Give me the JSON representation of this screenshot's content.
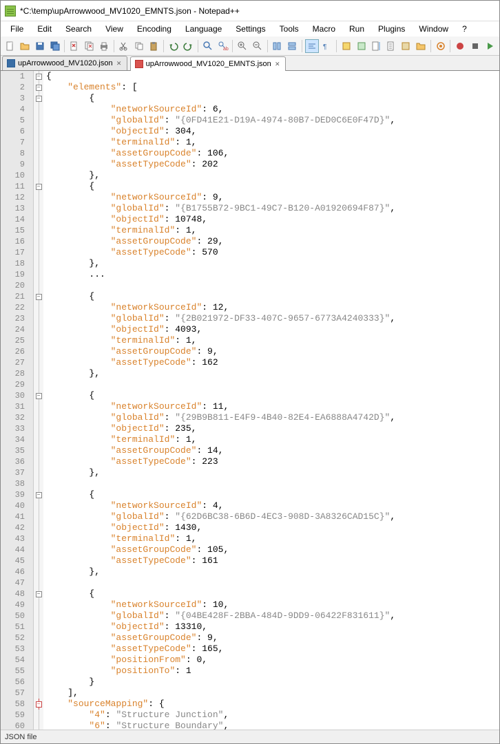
{
  "title": "*C:\\temp\\upArrowwood_MV1020_EMNTS.json - Notepad++",
  "menu": [
    "File",
    "Edit",
    "Search",
    "View",
    "Encoding",
    "Language",
    "Settings",
    "Tools",
    "Macro",
    "Run",
    "Plugins",
    "Window",
    "?"
  ],
  "tabs": [
    {
      "label": "upArrowwood_MV1020.json",
      "modified": false
    },
    {
      "label": "upArrowwood_MV1020_EMNTS.json",
      "modified": true
    }
  ],
  "active_tab": 1,
  "status": "JSON file",
  "code_lines": [
    {
      "n": 1,
      "fold": "open",
      "t": [
        {
          "c": "p",
          "v": "{"
        }
      ]
    },
    {
      "n": 2,
      "fold": "open",
      "t": [
        {
          "c": "p",
          "v": "    "
        },
        {
          "c": "k",
          "v": "\"elements\""
        },
        {
          "c": "p",
          "v": ": ["
        }
      ]
    },
    {
      "n": 3,
      "fold": "open",
      "t": [
        {
          "c": "p",
          "v": "        {"
        }
      ]
    },
    {
      "n": 4,
      "t": [
        {
          "c": "p",
          "v": "            "
        },
        {
          "c": "k",
          "v": "\"networkSourceId\""
        },
        {
          "c": "p",
          "v": ": 6,"
        }
      ]
    },
    {
      "n": 5,
      "t": [
        {
          "c": "p",
          "v": "            "
        },
        {
          "c": "k",
          "v": "\"globalId\""
        },
        {
          "c": "p",
          "v": ": "
        },
        {
          "c": "s",
          "v": "\"{0FD41E21-D19A-4974-80B7-DED0C6E0F47D}\""
        },
        {
          "c": "p",
          "v": ","
        }
      ]
    },
    {
      "n": 6,
      "t": [
        {
          "c": "p",
          "v": "            "
        },
        {
          "c": "k",
          "v": "\"objectId\""
        },
        {
          "c": "p",
          "v": ": 304,"
        }
      ]
    },
    {
      "n": 7,
      "t": [
        {
          "c": "p",
          "v": "            "
        },
        {
          "c": "k",
          "v": "\"terminalId\""
        },
        {
          "c": "p",
          "v": ": 1,"
        }
      ]
    },
    {
      "n": 8,
      "t": [
        {
          "c": "p",
          "v": "            "
        },
        {
          "c": "k",
          "v": "\"assetGroupCode\""
        },
        {
          "c": "p",
          "v": ": 106,"
        }
      ]
    },
    {
      "n": 9,
      "t": [
        {
          "c": "p",
          "v": "            "
        },
        {
          "c": "k",
          "v": "\"assetTypeCode\""
        },
        {
          "c": "p",
          "v": ": 202"
        }
      ]
    },
    {
      "n": 10,
      "t": [
        {
          "c": "p",
          "v": "        },"
        }
      ]
    },
    {
      "n": 11,
      "fold": "open",
      "t": [
        {
          "c": "p",
          "v": "        {"
        }
      ]
    },
    {
      "n": 12,
      "t": [
        {
          "c": "p",
          "v": "            "
        },
        {
          "c": "k",
          "v": "\"networkSourceId\""
        },
        {
          "c": "p",
          "v": ": 9,"
        }
      ]
    },
    {
      "n": 13,
      "t": [
        {
          "c": "p",
          "v": "            "
        },
        {
          "c": "k",
          "v": "\"globalId\""
        },
        {
          "c": "p",
          "v": ": "
        },
        {
          "c": "s",
          "v": "\"{B1755B72-9BC1-49C7-B120-A01920694F87}\""
        },
        {
          "c": "p",
          "v": ","
        }
      ]
    },
    {
      "n": 14,
      "t": [
        {
          "c": "p",
          "v": "            "
        },
        {
          "c": "k",
          "v": "\"objectId\""
        },
        {
          "c": "p",
          "v": ": 10748,"
        }
      ]
    },
    {
      "n": 15,
      "t": [
        {
          "c": "p",
          "v": "            "
        },
        {
          "c": "k",
          "v": "\"terminalId\""
        },
        {
          "c": "p",
          "v": ": 1,"
        }
      ]
    },
    {
      "n": 16,
      "t": [
        {
          "c": "p",
          "v": "            "
        },
        {
          "c": "k",
          "v": "\"assetGroupCode\""
        },
        {
          "c": "p",
          "v": ": 29,"
        }
      ]
    },
    {
      "n": 17,
      "t": [
        {
          "c": "p",
          "v": "            "
        },
        {
          "c": "k",
          "v": "\"assetTypeCode\""
        },
        {
          "c": "p",
          "v": ": 570"
        }
      ]
    },
    {
      "n": 18,
      "t": [
        {
          "c": "p",
          "v": "        },"
        }
      ]
    },
    {
      "n": 19,
      "t": [
        {
          "c": "p",
          "v": "        ..."
        }
      ]
    },
    {
      "n": 20,
      "t": [
        {
          "c": "p",
          "v": ""
        }
      ]
    },
    {
      "n": 21,
      "fold": "open",
      "t": [
        {
          "c": "p",
          "v": "        {"
        }
      ]
    },
    {
      "n": 22,
      "t": [
        {
          "c": "p",
          "v": "            "
        },
        {
          "c": "k",
          "v": "\"networkSourceId\""
        },
        {
          "c": "p",
          "v": ": 12,"
        }
      ]
    },
    {
      "n": 23,
      "t": [
        {
          "c": "p",
          "v": "            "
        },
        {
          "c": "k",
          "v": "\"globalId\""
        },
        {
          "c": "p",
          "v": ": "
        },
        {
          "c": "s",
          "v": "\"{2B021972-DF33-407C-9657-6773A4240333}\""
        },
        {
          "c": "p",
          "v": ","
        }
      ]
    },
    {
      "n": 24,
      "t": [
        {
          "c": "p",
          "v": "            "
        },
        {
          "c": "k",
          "v": "\"objectId\""
        },
        {
          "c": "p",
          "v": ": 4093,"
        }
      ]
    },
    {
      "n": 25,
      "t": [
        {
          "c": "p",
          "v": "            "
        },
        {
          "c": "k",
          "v": "\"terminalId\""
        },
        {
          "c": "p",
          "v": ": 1,"
        }
      ]
    },
    {
      "n": 26,
      "t": [
        {
          "c": "p",
          "v": "            "
        },
        {
          "c": "k",
          "v": "\"assetGroupCode\""
        },
        {
          "c": "p",
          "v": ": 9,"
        }
      ]
    },
    {
      "n": 27,
      "t": [
        {
          "c": "p",
          "v": "            "
        },
        {
          "c": "k",
          "v": "\"assetTypeCode\""
        },
        {
          "c": "p",
          "v": ": 162"
        }
      ]
    },
    {
      "n": 28,
      "t": [
        {
          "c": "p",
          "v": "        },"
        }
      ]
    },
    {
      "n": 29,
      "t": [
        {
          "c": "p",
          "v": ""
        }
      ]
    },
    {
      "n": 30,
      "fold": "open",
      "t": [
        {
          "c": "p",
          "v": "        {"
        }
      ]
    },
    {
      "n": 31,
      "t": [
        {
          "c": "p",
          "v": "            "
        },
        {
          "c": "k",
          "v": "\"networkSourceId\""
        },
        {
          "c": "p",
          "v": ": 11,"
        }
      ]
    },
    {
      "n": 32,
      "t": [
        {
          "c": "p",
          "v": "            "
        },
        {
          "c": "k",
          "v": "\"globalId\""
        },
        {
          "c": "p",
          "v": ": "
        },
        {
          "c": "s",
          "v": "\"{29B9B811-E4F9-4B40-82E4-EA6888A4742D}\""
        },
        {
          "c": "p",
          "v": ","
        }
      ]
    },
    {
      "n": 33,
      "t": [
        {
          "c": "p",
          "v": "            "
        },
        {
          "c": "k",
          "v": "\"objectId\""
        },
        {
          "c": "p",
          "v": ": 235,"
        }
      ]
    },
    {
      "n": 34,
      "t": [
        {
          "c": "p",
          "v": "            "
        },
        {
          "c": "k",
          "v": "\"terminalId\""
        },
        {
          "c": "p",
          "v": ": 1,"
        }
      ]
    },
    {
      "n": 35,
      "t": [
        {
          "c": "p",
          "v": "            "
        },
        {
          "c": "k",
          "v": "\"assetGroupCode\""
        },
        {
          "c": "p",
          "v": ": 14,"
        }
      ]
    },
    {
      "n": 36,
      "t": [
        {
          "c": "p",
          "v": "            "
        },
        {
          "c": "k",
          "v": "\"assetTypeCode\""
        },
        {
          "c": "p",
          "v": ": 223"
        }
      ]
    },
    {
      "n": 37,
      "t": [
        {
          "c": "p",
          "v": "        },"
        }
      ]
    },
    {
      "n": 38,
      "t": [
        {
          "c": "p",
          "v": ""
        }
      ]
    },
    {
      "n": 39,
      "fold": "open",
      "t": [
        {
          "c": "p",
          "v": "        {"
        }
      ]
    },
    {
      "n": 40,
      "t": [
        {
          "c": "p",
          "v": "            "
        },
        {
          "c": "k",
          "v": "\"networkSourceId\""
        },
        {
          "c": "p",
          "v": ": 4,"
        }
      ]
    },
    {
      "n": 41,
      "t": [
        {
          "c": "p",
          "v": "            "
        },
        {
          "c": "k",
          "v": "\"globalId\""
        },
        {
          "c": "p",
          "v": ": "
        },
        {
          "c": "s",
          "v": "\"{62D6BC38-6B6D-4EC3-908D-3A8326CAD15C}\""
        },
        {
          "c": "p",
          "v": ","
        }
      ]
    },
    {
      "n": 42,
      "t": [
        {
          "c": "p",
          "v": "            "
        },
        {
          "c": "k",
          "v": "\"objectId\""
        },
        {
          "c": "p",
          "v": ": 1430,"
        }
      ]
    },
    {
      "n": 43,
      "t": [
        {
          "c": "p",
          "v": "            "
        },
        {
          "c": "k",
          "v": "\"terminalId\""
        },
        {
          "c": "p",
          "v": ": 1,"
        }
      ]
    },
    {
      "n": 44,
      "t": [
        {
          "c": "p",
          "v": "            "
        },
        {
          "c": "k",
          "v": "\"assetGroupCode\""
        },
        {
          "c": "p",
          "v": ": 105,"
        }
      ]
    },
    {
      "n": 45,
      "t": [
        {
          "c": "p",
          "v": "            "
        },
        {
          "c": "k",
          "v": "\"assetTypeCode\""
        },
        {
          "c": "p",
          "v": ": 161"
        }
      ]
    },
    {
      "n": 46,
      "t": [
        {
          "c": "p",
          "v": "        },"
        }
      ]
    },
    {
      "n": 47,
      "t": [
        {
          "c": "p",
          "v": ""
        }
      ]
    },
    {
      "n": 48,
      "fold": "open",
      "t": [
        {
          "c": "p",
          "v": "        {"
        }
      ]
    },
    {
      "n": 49,
      "t": [
        {
          "c": "p",
          "v": "            "
        },
        {
          "c": "k",
          "v": "\"networkSourceId\""
        },
        {
          "c": "p",
          "v": ": 10,"
        }
      ]
    },
    {
      "n": 50,
      "t": [
        {
          "c": "p",
          "v": "            "
        },
        {
          "c": "k",
          "v": "\"globalId\""
        },
        {
          "c": "p",
          "v": ": "
        },
        {
          "c": "s",
          "v": "\"{04BE428F-2BBA-484D-9DD9-06422F831611}\""
        },
        {
          "c": "p",
          "v": ","
        }
      ]
    },
    {
      "n": 51,
      "t": [
        {
          "c": "p",
          "v": "            "
        },
        {
          "c": "k",
          "v": "\"objectId\""
        },
        {
          "c": "p",
          "v": ": 13310,"
        }
      ]
    },
    {
      "n": 52,
      "t": [
        {
          "c": "p",
          "v": "            "
        },
        {
          "c": "k",
          "v": "\"assetGroupCode\""
        },
        {
          "c": "p",
          "v": ": 9,"
        }
      ]
    },
    {
      "n": 53,
      "t": [
        {
          "c": "p",
          "v": "            "
        },
        {
          "c": "k",
          "v": "\"assetTypeCode\""
        },
        {
          "c": "p",
          "v": ": 165,"
        }
      ]
    },
    {
      "n": 54,
      "t": [
        {
          "c": "p",
          "v": "            "
        },
        {
          "c": "k",
          "v": "\"positionFrom\""
        },
        {
          "c": "p",
          "v": ": 0,"
        }
      ]
    },
    {
      "n": 55,
      "t": [
        {
          "c": "p",
          "v": "            "
        },
        {
          "c": "k",
          "v": "\"positionTo\""
        },
        {
          "c": "p",
          "v": ": 1"
        }
      ]
    },
    {
      "n": 56,
      "t": [
        {
          "c": "p",
          "v": "        }"
        }
      ]
    },
    {
      "n": 57,
      "t": [
        {
          "c": "p",
          "v": "    ],"
        }
      ]
    },
    {
      "n": 58,
      "fold": "open-red",
      "t": [
        {
          "c": "p",
          "v": "    "
        },
        {
          "c": "k",
          "v": "\"sourceMapping\""
        },
        {
          "c": "p",
          "v": ": {"
        }
      ]
    },
    {
      "n": 59,
      "t": [
        {
          "c": "p",
          "v": "        "
        },
        {
          "c": "k",
          "v": "\"4\""
        },
        {
          "c": "p",
          "v": ": "
        },
        {
          "c": "s",
          "v": "\"Structure Junction\""
        },
        {
          "c": "p",
          "v": ","
        }
      ]
    },
    {
      "n": 60,
      "t": [
        {
          "c": "p",
          "v": "        "
        },
        {
          "c": "k",
          "v": "\"6\""
        },
        {
          "c": "p",
          "v": ": "
        },
        {
          "c": "s",
          "v": "\"Structure Boundary\""
        },
        {
          "c": "p",
          "v": ","
        }
      ]
    }
  ]
}
